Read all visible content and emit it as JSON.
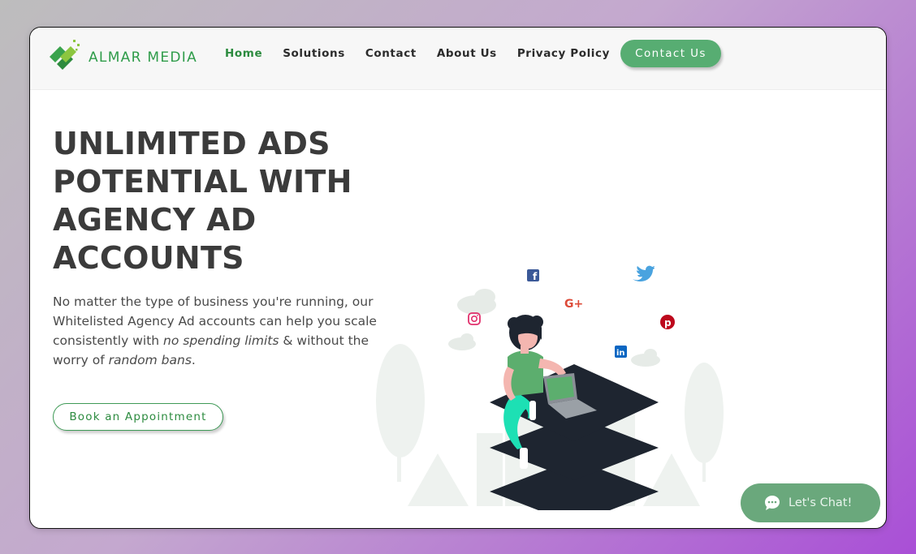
{
  "brand": {
    "name": "ALMAR MEDIA",
    "logo_icon": "almar-logo-icon",
    "color": "#2f9c4a"
  },
  "nav": {
    "items": [
      {
        "label": "Home",
        "active": true
      },
      {
        "label": "Solutions",
        "active": false
      },
      {
        "label": "Contact",
        "active": false
      },
      {
        "label": "About Us",
        "active": false
      },
      {
        "label": "Privacy Policy",
        "active": false
      }
    ],
    "cta_label": "Contact Us"
  },
  "hero": {
    "title": "UNLIMITED ADS POTENTIAL WITH AGENCY AD ACCOUNTS",
    "text_part1": "No matter the type of business you're running, our Whitelisted Agency Ad accounts can help you scale consistently with ",
    "text_em1": "no spending limits",
    "text_part2": " & without the worry of ",
    "text_em2": "random bans",
    "text_part3": ".",
    "button_label": "Book an Appointment"
  },
  "illustration": {
    "icons": [
      "facebook-icon",
      "twitter-icon",
      "google-plus-icon",
      "instagram-icon",
      "pinterest-icon",
      "linkedin-icon"
    ],
    "google_plus_text": "G+"
  },
  "chat": {
    "label": "Let's Chat!",
    "icon": "chat-bubble-icon"
  },
  "colors": {
    "accent": "#57ad72",
    "nav_active": "#2c8b3f",
    "title": "#3b3b3b",
    "chat": "#6aa87c"
  }
}
